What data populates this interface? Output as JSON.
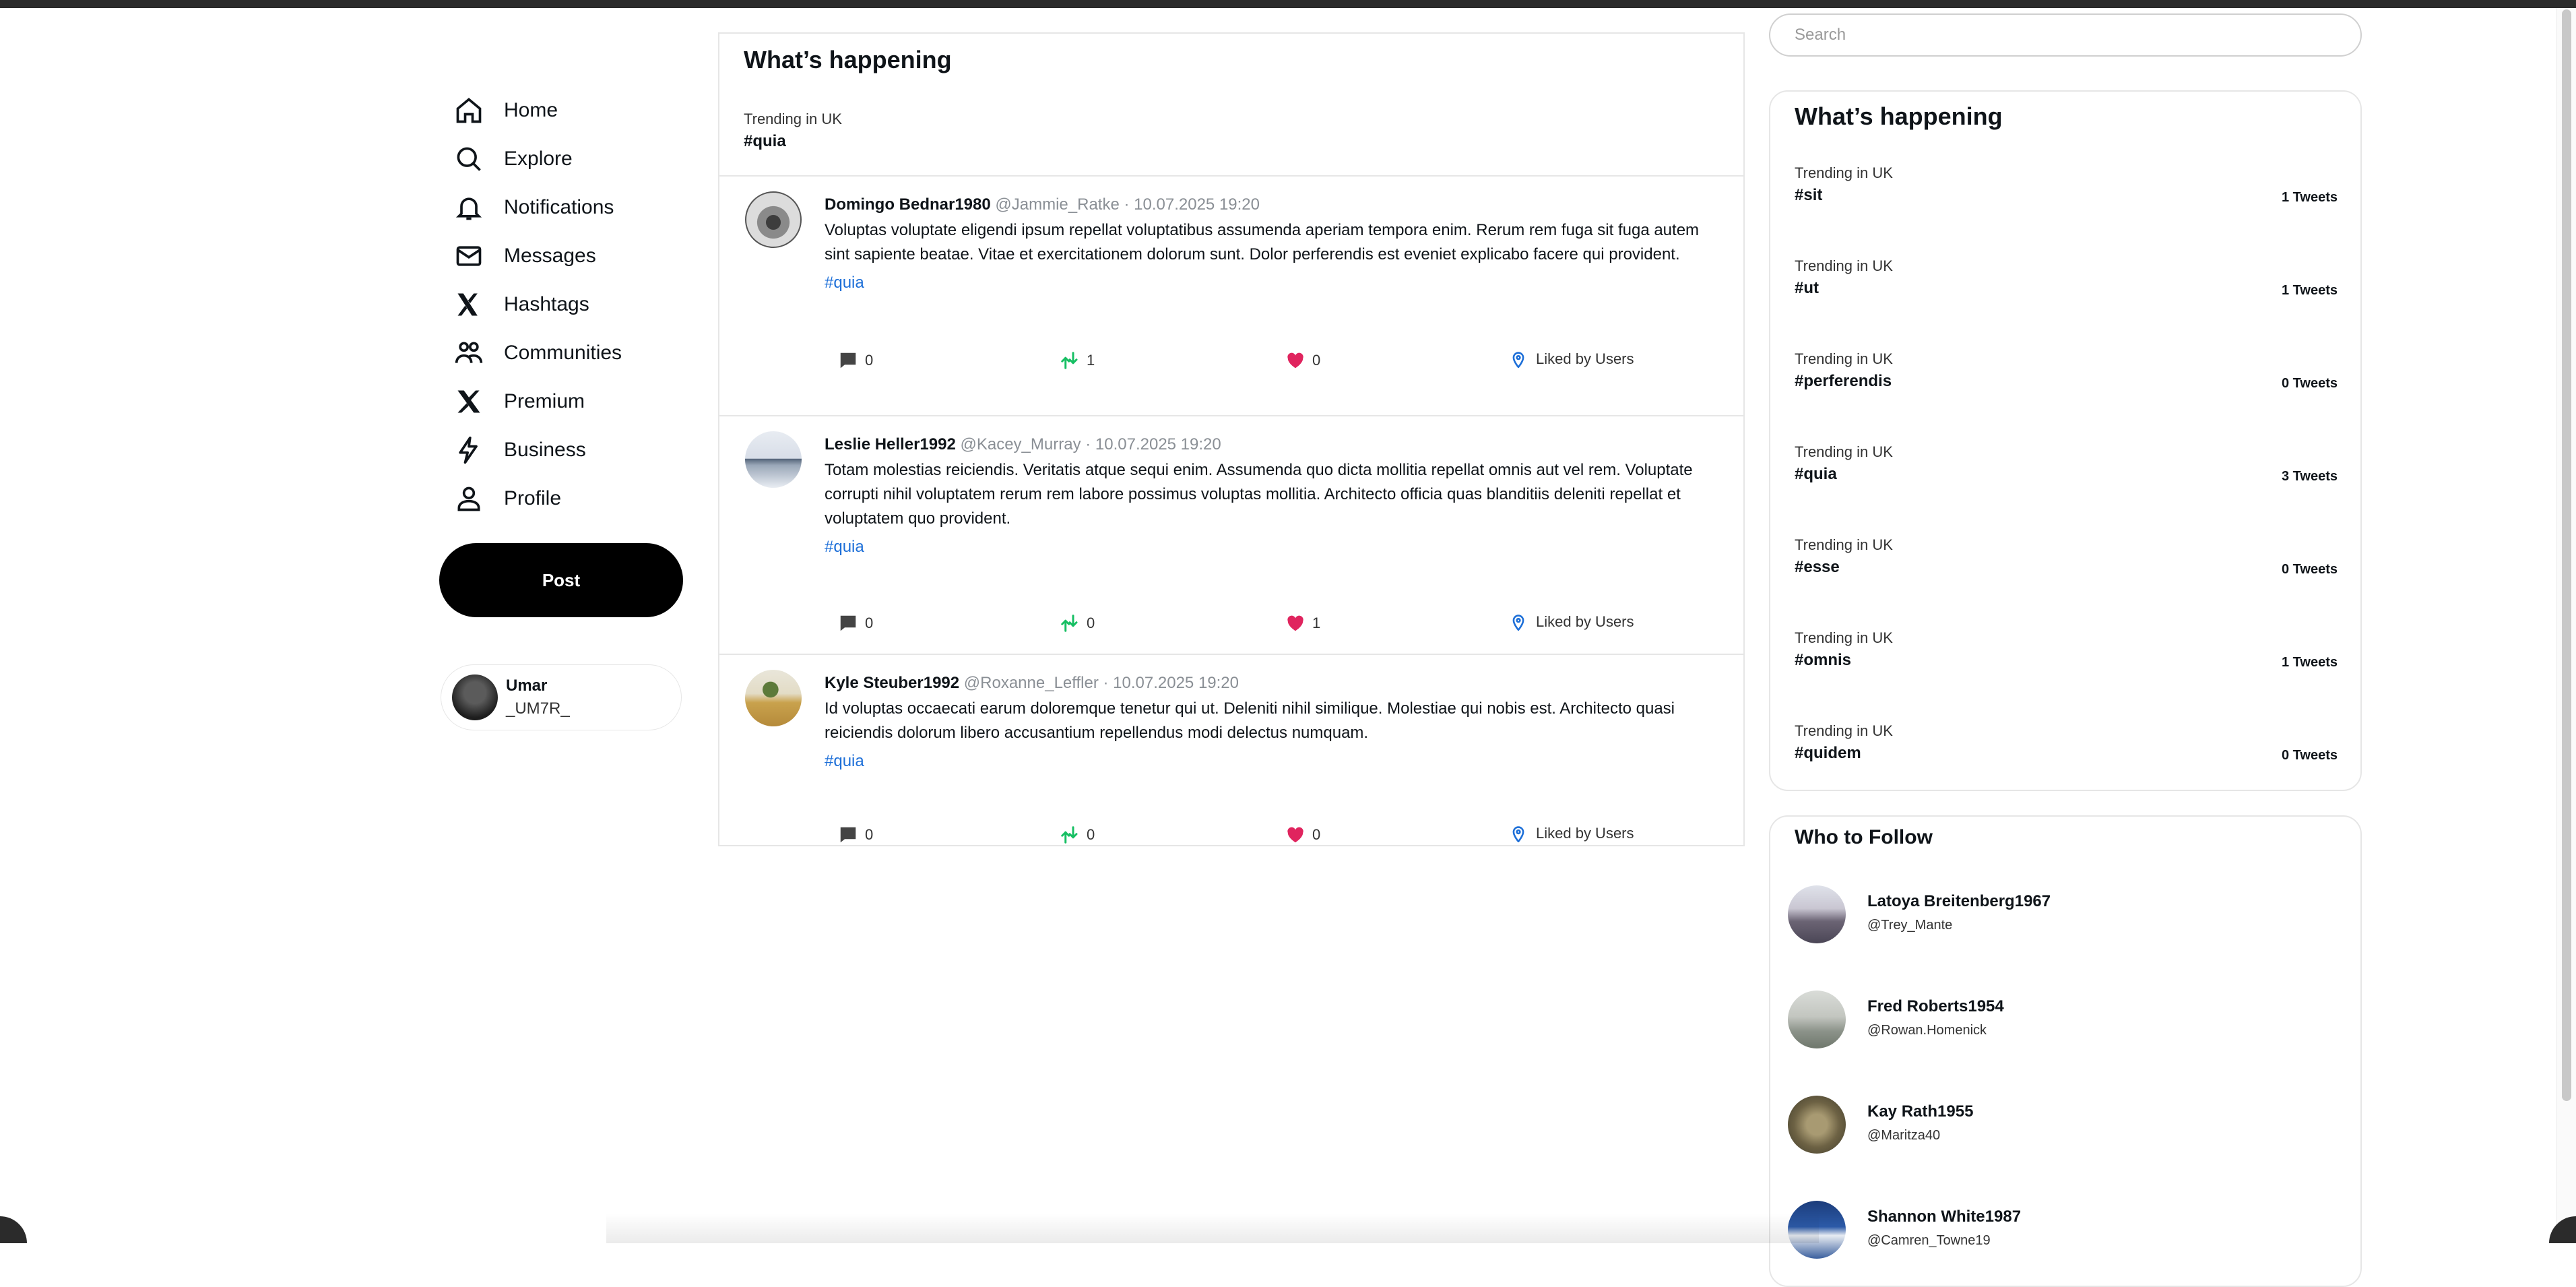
{
  "nav": {
    "items": [
      {
        "label": "Home",
        "icon": "home-icon"
      },
      {
        "label": "Explore",
        "icon": "search-icon"
      },
      {
        "label": "Notifications",
        "icon": "bell-icon"
      },
      {
        "label": "Messages",
        "icon": "mail-icon"
      },
      {
        "label": "Hashtags",
        "icon": "hashtag-icon"
      },
      {
        "label": "Communities",
        "icon": "communities-icon"
      },
      {
        "label": "Premium",
        "icon": "x-logo-icon"
      },
      {
        "label": "Business",
        "icon": "lightning-icon"
      },
      {
        "label": "Profile",
        "icon": "person-icon"
      }
    ],
    "post_label": "Post",
    "user": {
      "name": "Umar",
      "handle": "_UM7R_"
    }
  },
  "feed": {
    "title": "What’s happening",
    "trend_label": "Trending in UK",
    "trend_tag": "#quia",
    "tweets": [
      {
        "name": "Domingo Bednar1980",
        "meta": "@Jammie_Ratke · 10.07.2025 19:20",
        "text": "Voluptas voluptate eligendi ipsum repellat voluptatibus assumenda aperiam tempora enim. Rerum rem fuga sit fuga autem sint sapiente beatae. Vitae et exercitationem dolorum sunt. Dolor perferendis est eveniet explicabo facere qui provident.",
        "hashtag": "#quia",
        "replies": "0",
        "retweets": "1",
        "likes": "0",
        "liked_by": "Liked by Users"
      },
      {
        "name": "Leslie Heller1992",
        "meta": "@Kacey_Murray · 10.07.2025 19:20",
        "text": "Totam molestias reiciendis. Veritatis atque sequi enim. Assumenda quo dicta mollitia repellat omnis aut vel rem. Voluptate corrupti nihil voluptatem rerum rem labore possimus voluptas mollitia. Architecto officia quas blanditiis deleniti repellat et voluptatem quo provident.",
        "hashtag": "#quia",
        "replies": "0",
        "retweets": "0",
        "likes": "1",
        "liked_by": "Liked by Users"
      },
      {
        "name": "Kyle Steuber1992",
        "meta": "@Roxanne_Leffler · 10.07.2025 19:20",
        "text": "Id voluptas occaecati earum doloremque tenetur qui ut. Deleniti nihil similique. Molestiae qui nobis est. Architecto quasi reiciendis dolorum libero accusantium repellendus modi delectus numquam.",
        "hashtag": "#quia",
        "replies": "0",
        "retweets": "0",
        "likes": "0",
        "liked_by": "Liked by Users"
      }
    ]
  },
  "search": {
    "placeholder": "Search"
  },
  "trends": {
    "title": "What’s happening",
    "items": [
      {
        "label": "Trending in UK",
        "tag": "#sit",
        "count": "1 Tweets"
      },
      {
        "label": "Trending in UK",
        "tag": "#ut",
        "count": "1 Tweets"
      },
      {
        "label": "Trending in UK",
        "tag": "#perferendis",
        "count": "0 Tweets"
      },
      {
        "label": "Trending in UK",
        "tag": "#quia",
        "count": "3 Tweets"
      },
      {
        "label": "Trending in UK",
        "tag": "#esse",
        "count": "0 Tweets"
      },
      {
        "label": "Trending in UK",
        "tag": "#omnis",
        "count": "1 Tweets"
      },
      {
        "label": "Trending in UK",
        "tag": "#quidem",
        "count": "0 Tweets"
      }
    ]
  },
  "follow": {
    "title": "Who to Follow",
    "items": [
      {
        "name": "Latoya Breitenberg1967",
        "handle": "@Trey_Mante"
      },
      {
        "name": "Fred Roberts1954",
        "handle": "@Rowan.Homenick"
      },
      {
        "name": "Kay Rath1955",
        "handle": "@Maritza40"
      },
      {
        "name": "Shannon White1987",
        "handle": "@Camren_Towne19"
      }
    ]
  },
  "colors": {
    "accent": "#1d6fd8",
    "like": "#e0245e",
    "retweet": "#17bf63",
    "post_button": "#000000"
  }
}
